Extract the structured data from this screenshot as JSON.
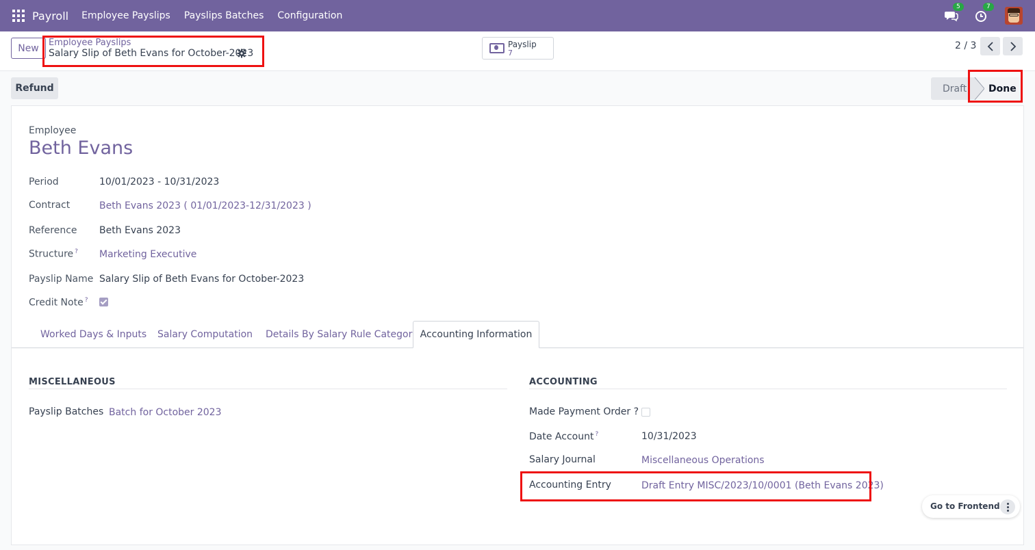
{
  "navbar": {
    "app_name": "Payroll",
    "menu": [
      "Employee Payslips",
      "Payslips Batches",
      "Configuration"
    ],
    "messages_count": "5",
    "activities_count": "7"
  },
  "control": {
    "new_label": "New",
    "breadcrumb_parent": "Employee Payslips",
    "breadcrumb_current": "Salary Slip of Beth Evans for October-2023",
    "smart_button_label": "Payslip",
    "smart_button_value": "7",
    "pager": "2 / 3"
  },
  "statusbar": {
    "refund_label": "Refund",
    "states": [
      "Draft",
      "Done"
    ]
  },
  "form": {
    "employee_label": "Employee",
    "employee_name": "Beth Evans",
    "fields": {
      "period_label": "Period",
      "period_value": "10/01/2023 - 10/31/2023",
      "contract_label": "Contract",
      "contract_value": "Beth Evans 2023 ( 01/01/2023-12/31/2023 )",
      "reference_label": "Reference",
      "reference_value": "Beth Evans 2023",
      "structure_label": "Structure",
      "structure_value": "Marketing Executive",
      "payslip_name_label": "Payslip Name",
      "payslip_name_value": "Salary Slip of Beth Evans for October-2023",
      "credit_note_label": "Credit Note",
      "help_mark": "?"
    },
    "tabs": [
      "Worked Days & Inputs",
      "Salary Computation",
      "Details By Salary Rule Category",
      "Accounting Information"
    ],
    "misc": {
      "title": "MISCELLANEOUS",
      "batches_label": "Payslip Batches",
      "batches_value": "Batch for October 2023"
    },
    "accounting": {
      "title": "ACCOUNTING",
      "payment_order_label": "Made Payment Order ?",
      "date_account_label": "Date Account",
      "date_account_value": "10/31/2023",
      "journal_label": "Salary Journal",
      "journal_value": "Miscellaneous Operations",
      "entry_label": "Accounting Entry",
      "entry_value": "Draft Entry MISC/2023/10/0001 (Beth Evans 2023)"
    }
  },
  "frontend": {
    "label": "Go to Frontend"
  },
  "colors": {
    "brand": "#71639e",
    "highlight": "#ee1111"
  }
}
